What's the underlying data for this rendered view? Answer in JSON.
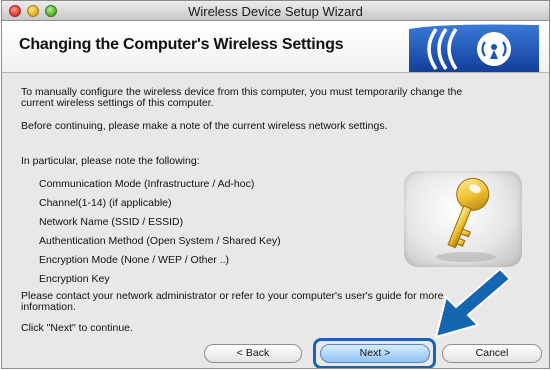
{
  "window": {
    "title": "Wireless Device Setup Wizard"
  },
  "header": {
    "heading": "Changing the Computer's Wireless Settings"
  },
  "body": {
    "intro_line1": "To manually configure the wireless device from this computer, you must temporarily change the",
    "intro_line2": "current wireless settings of this computer.",
    "before_note": "Before continuing, please make a note of the current wireless network settings.",
    "particular": "In particular, please note the following:",
    "items": [
      "Communication Mode (Infrastructure / Ad-hoc)",
      "Channel(1-14) (if applicable)",
      "Network Name (SSID / ESSID)",
      "Authentication Method (Open System / Shared Key)",
      "Encryption Mode (None / WEP / Other ..)",
      "Encryption Key"
    ],
    "contact_line1": "Please contact your network administrator or refer to your computer's user's guide for more",
    "contact_line2": "information.",
    "click_next": "Click \"Next\" to continue."
  },
  "buttons": {
    "back": "< Back",
    "next": "Next >",
    "cancel": "Cancel"
  },
  "icons": {
    "logo": "wireless-signal-icon",
    "image": "key-icon",
    "pointer": "arrow-pointer-icon"
  },
  "colors": {
    "accent_blue": "#1566b0",
    "logo_blue": "#1a56b8",
    "key_gold": "#e8b82a"
  }
}
